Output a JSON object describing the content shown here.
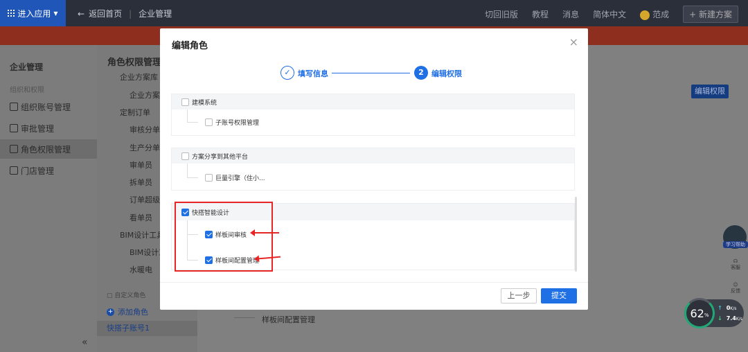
{
  "topbar": {
    "app_button": "进入应用",
    "back": "返回首页",
    "section": "企业管理",
    "right_items": [
      "切回旧版",
      "教程",
      "消息",
      "简体中文"
    ],
    "user": "范成",
    "new_button": "新建方案"
  },
  "left_nav": {
    "title": "企业管理",
    "subtitle": "组织和权限",
    "items": [
      "组织账号管理",
      "审批管理",
      "角色权限管理",
      "门店管理"
    ]
  },
  "mid": {
    "title": "角色权限管理",
    "items": [
      "企业方案库",
      "企业方案库",
      "定制订单",
      "审核分单员",
      "生产分单员",
      "审单员",
      "拆单员",
      "订单超级管",
      "看单员",
      "BIM设计工具",
      "BIM设计工",
      "水暖电"
    ],
    "custom_role_label": "自定义角色",
    "add_role": "添加角色",
    "account": "快搭子账号1"
  },
  "main": {
    "edit_permission": "编辑权限",
    "bg_row": "样板间配置管理"
  },
  "floating": {
    "robot_label": "学习帮助",
    "icon1": "客服",
    "icon2": "反馈"
  },
  "speed": {
    "percent": "62",
    "unit": "%",
    "up": "0",
    "up_unit": "K/s",
    "down": "7.4",
    "down_unit": "K/s"
  },
  "modal": {
    "title": "编辑角色",
    "close": "×",
    "steps": [
      {
        "label": "填写信息",
        "state": "done"
      },
      {
        "number": "2",
        "label": "编辑权限",
        "state": "active"
      }
    ],
    "groups": [
      {
        "label": "建模系统",
        "checked": false,
        "children": [
          {
            "label": "子账号权限管理",
            "checked": false
          }
        ]
      },
      {
        "label": "方案分享到其他平台",
        "checked": false,
        "children": [
          {
            "label": "巨量引擎（住小...",
            "checked": false
          }
        ]
      },
      {
        "label": "快搭智能设计",
        "checked": true,
        "children": [
          {
            "label": "样板间审核",
            "checked": true
          },
          {
            "label": "样板间配置管理",
            "checked": true
          }
        ]
      }
    ],
    "prev_button": "上一步",
    "submit_button": "提交"
  },
  "colors": {
    "primary": "#1f6fe5",
    "annotation": "#e82525",
    "topbar": "#2b2f3a"
  }
}
